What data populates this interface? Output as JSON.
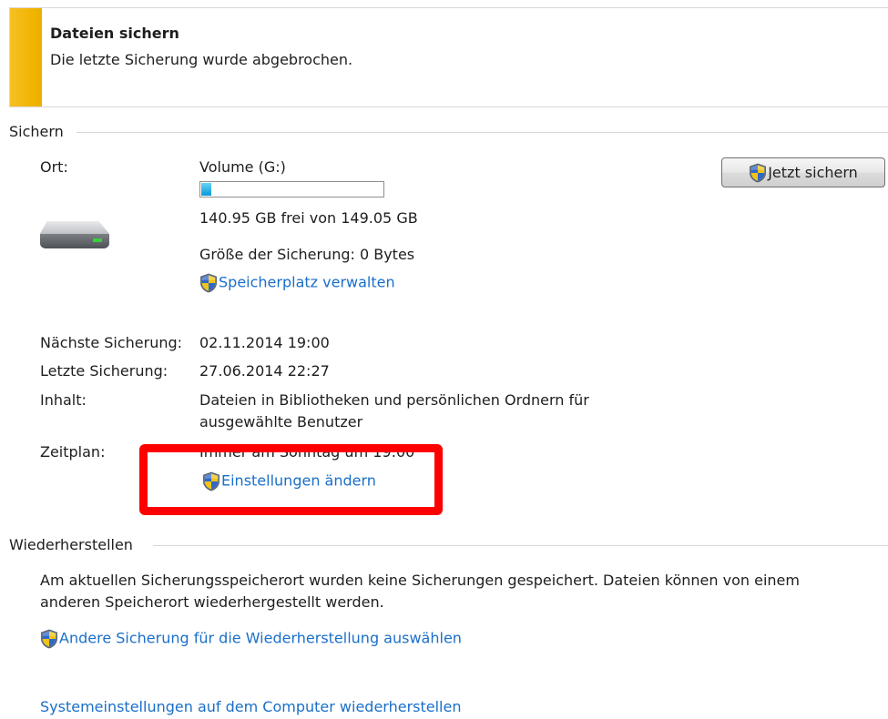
{
  "banner": {
    "title": "Dateien sichern",
    "message": "Die letzte Sicherung wurde abgebrochen.",
    "accent_color": "#f1b400"
  },
  "backup": {
    "section_title": "Sichern",
    "location_label": "Ort:",
    "volume_name": "Volume (G:)",
    "usage_fraction": 0.054,
    "free_space_text": "140.95 GB frei von 149.05 GB",
    "backup_size_text": "Größe der Sicherung: 0 Bytes",
    "manage_space_link": "Speicherplatz verwalten",
    "backup_now_button": "Jetzt sichern",
    "next_backup_label": "Nächste Sicherung:",
    "next_backup_value": "02.11.2014 19:00",
    "last_backup_label": "Letzte Sicherung:",
    "last_backup_value": "27.06.2014 22:27",
    "contents_label": "Inhalt:",
    "contents_line1": "Dateien in Bibliotheken und persönlichen Ordnern für",
    "contents_line2": "ausgewählte Benutzer",
    "schedule_label": "Zeitplan:",
    "schedule_value": "Immer am Sonntag um 19:00",
    "change_settings_link": "Einstellungen ändern",
    "highlight_color": "#ff0000"
  },
  "restore": {
    "section_title": "Wiederherstellen",
    "message_line1": "Am aktuellen Sicherungsspeicherort wurden keine Sicherungen gespeichert. Dateien können von einem",
    "message_line2": "anderen Speicherort wiederhergestellt werden.",
    "select_other_link": "Andere Sicherung für die Wiederherstellung auswählen",
    "system_restore_link": "Systemeinstellungen auf dem Computer wiederherstellen"
  },
  "icons": {
    "drive": "hard-drive-icon",
    "shield": "uac-shield-icon"
  },
  "link_color": "#1a6fc9"
}
